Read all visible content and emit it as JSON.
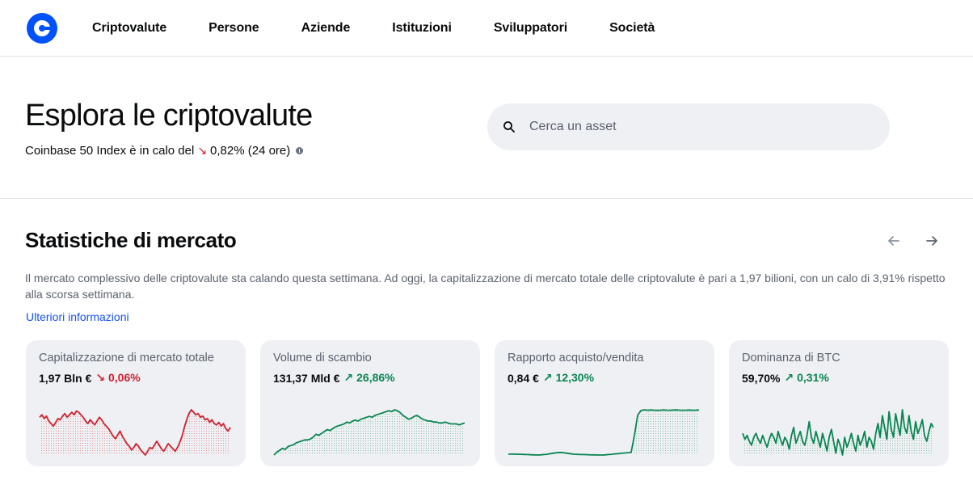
{
  "nav": {
    "items": [
      "Criptovalute",
      "Persone",
      "Aziende",
      "Istituzioni",
      "Sviluppatori",
      "Società"
    ]
  },
  "hero": {
    "title": "Esplora le criptovalute",
    "subtitle_prefix": "Coinbase 50 Index è in calo del",
    "subtitle_arrow": "↘",
    "subtitle_value": "0,82% (24 ore)"
  },
  "search": {
    "placeholder": "Cerca un asset"
  },
  "stats": {
    "title": "Statistiche di mercato",
    "description": "Il mercato complessivo delle criptovalute sta calando questa settimana. Ad oggi, la capitalizzazione di mercato totale delle criptovalute è pari a 1,97 bilioni, con un calo di 3,91% rispetto alla scorsa settimana.",
    "more_link": "Ulteriori informazioni"
  },
  "cards": [
    {
      "title": "Capitalizzazione di mercato totale",
      "value": "1,97 Bln €",
      "arrow": "↘",
      "change": "0,06%",
      "direction": "down",
      "color": "#cf202f",
      "series": [
        45,
        47,
        44,
        46,
        42,
        40,
        38,
        41,
        44,
        43,
        46,
        48,
        45,
        47,
        49,
        47,
        50,
        49,
        47,
        45,
        42,
        40,
        43,
        41,
        39,
        42,
        45,
        43,
        40,
        38,
        36,
        33,
        30,
        28,
        31,
        34,
        30,
        27,
        24,
        22,
        19,
        21,
        24,
        22,
        19,
        17,
        15,
        18,
        21,
        20,
        23,
        26,
        23,
        20,
        18,
        21,
        24,
        22,
        20,
        18,
        21,
        25,
        30,
        37,
        43,
        48,
        51,
        49,
        47,
        48,
        45,
        46,
        43,
        44,
        41,
        43,
        40,
        39,
        41,
        38,
        40,
        36,
        34,
        37
      ]
    },
    {
      "title": "Volume di scambio",
      "value": "131,37 Mld €",
      "arrow": "↗",
      "change": "26,86%",
      "direction": "up",
      "color": "#098551",
      "series": [
        5,
        8,
        10,
        12,
        11,
        14,
        15,
        16,
        18,
        19,
        20,
        21,
        21,
        22,
        24,
        27,
        26,
        28,
        30,
        32,
        31,
        33,
        35,
        36,
        37,
        38,
        40,
        39,
        41,
        42,
        41,
        43,
        44,
        45,
        46,
        45,
        47,
        48,
        49,
        50,
        51,
        52,
        51,
        53,
        52,
        50,
        47,
        45,
        43,
        44,
        46,
        47,
        45,
        43,
        42,
        41,
        41,
        40,
        40,
        39,
        39,
        40,
        39,
        38,
        38,
        38,
        37,
        38,
        39
      ]
    },
    {
      "title": "Rapporto acquisto/vendita",
      "value": "0,84 €",
      "arrow": "↗",
      "change": "12,30%",
      "direction": "up",
      "color": "#098551",
      "series": [
        10,
        10,
        10,
        9.8,
        9.8,
        9.6,
        9.5,
        9.3,
        9.2,
        9.0,
        9.2,
        9.5,
        9.8,
        10.5,
        11,
        11.5,
        11.8,
        11.5,
        11,
        10.5,
        10,
        9.8,
        9.6,
        9.5,
        9.4,
        9.3,
        9.2,
        9.1,
        9.0,
        9.0,
        9.2,
        9.5,
        9.8,
        10.2,
        10.5,
        10.8,
        11.2,
        11.5,
        12,
        30,
        52,
        57,
        58,
        57.5,
        57.8,
        57.6,
        57.4,
        57.5,
        57.8,
        57.6,
        57.5,
        57.7,
        57.8,
        57.6,
        57.5,
        57.6,
        57.7,
        57.5,
        57.6,
        57.8
      ]
    },
    {
      "title": "Dominanza di BTC",
      "value": "59,70%",
      "arrow": "↗",
      "change": "0,31%",
      "direction": "up",
      "color": "#098551",
      "series": [
        30,
        27,
        29,
        26,
        24,
        28,
        30,
        27,
        25,
        29,
        26,
        23,
        27,
        30,
        28,
        25,
        31,
        27,
        24,
        28,
        26,
        22,
        29,
        33,
        25,
        28,
        31,
        26,
        24,
        29,
        36,
        28,
        25,
        31,
        27,
        23,
        30,
        26,
        21,
        28,
        32,
        26,
        20,
        27,
        24,
        19,
        28,
        23,
        26,
        30,
        25,
        21,
        29,
        24,
        27,
        31,
        23,
        28,
        26,
        22,
        30,
        35,
        28,
        39,
        33,
        27,
        41,
        32,
        28,
        40,
        34,
        29,
        42,
        33,
        30,
        39,
        31,
        27,
        36,
        30,
        33,
        37,
        29,
        26,
        31,
        35,
        33
      ]
    }
  ]
}
